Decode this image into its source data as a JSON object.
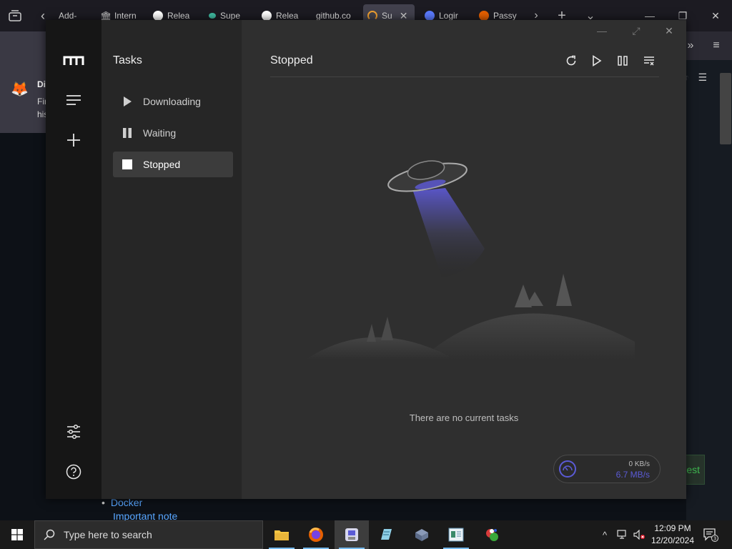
{
  "browser": {
    "tabs": [
      {
        "label": "Add-",
        "color": "#000000"
      },
      {
        "label": "Intern",
        "color": "#cccccc"
      },
      {
        "label": "Relea",
        "color": "#ffffff"
      },
      {
        "label": "Supe",
        "color": "#3fb9a0"
      },
      {
        "label": "Relea",
        "color": "#ffffff"
      },
      {
        "label": "github.co",
        "color": "#000000"
      },
      {
        "label": "Su",
        "color": "#f0a030"
      },
      {
        "label": "Logir",
        "color": "#5b7bff"
      },
      {
        "label": "Passy",
        "color": "#e66000"
      }
    ],
    "notification": {
      "title": "Di",
      "line1": "Fir",
      "line2": "his"
    },
    "page": {
      "bullet": "Docker",
      "subbullet": "Important note",
      "button_fragment": "est"
    }
  },
  "app": {
    "nav_title": "Tasks",
    "nav_items": [
      {
        "label": "Downloading"
      },
      {
        "label": "Waiting"
      },
      {
        "label": "Stopped"
      }
    ],
    "main_title": "Stopped",
    "empty_message": "There are no current tasks",
    "speed": {
      "upload": "0 KB/s",
      "download": "6.7 MB/s"
    }
  },
  "taskbar": {
    "search_placeholder": "Type here to search",
    "time": "12:09 PM",
    "date": "12/20/2024",
    "notification_count": "3"
  },
  "colors": {
    "accent": "#5b5bd6",
    "app_bg": "#2f2f2f",
    "rail_bg": "#161616"
  }
}
